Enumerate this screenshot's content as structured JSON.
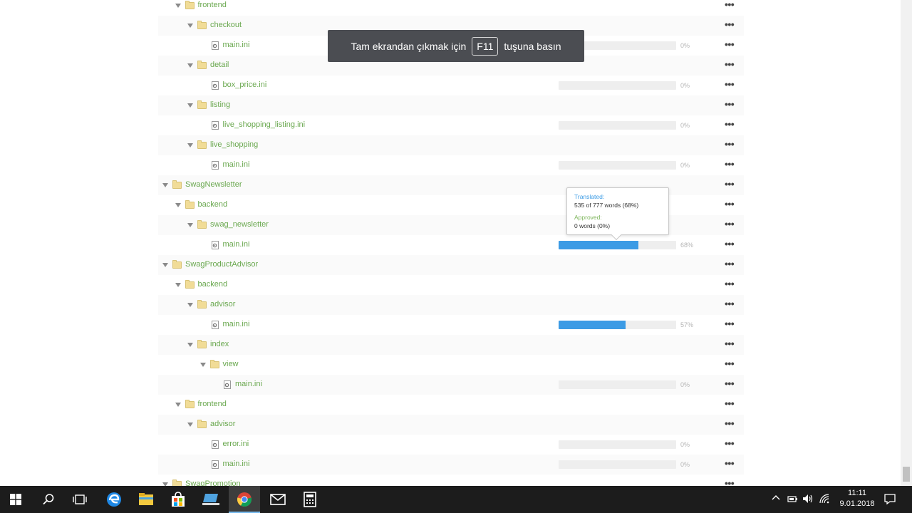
{
  "tree": [
    {
      "depth": 1,
      "kind": "folder",
      "name": "frontend"
    },
    {
      "depth": 2,
      "kind": "folder",
      "name": "checkout"
    },
    {
      "depth": 3,
      "kind": "file",
      "name": "main.ini",
      "progress": 0,
      "percent_label": "0%"
    },
    {
      "depth": 2,
      "kind": "folder",
      "name": "detail"
    },
    {
      "depth": 3,
      "kind": "file",
      "name": "box_price.ini",
      "progress": 0,
      "percent_label": "0%"
    },
    {
      "depth": 2,
      "kind": "folder",
      "name": "listing"
    },
    {
      "depth": 3,
      "kind": "file",
      "name": "live_shopping_listing.ini",
      "progress": 0,
      "percent_label": "0%"
    },
    {
      "depth": 2,
      "kind": "folder",
      "name": "live_shopping"
    },
    {
      "depth": 3,
      "kind": "file",
      "name": "main.ini",
      "progress": 0,
      "percent_label": "0%"
    },
    {
      "depth": 0,
      "kind": "folder",
      "name": "SwagNewsletter"
    },
    {
      "depth": 1,
      "kind": "folder",
      "name": "backend"
    },
    {
      "depth": 2,
      "kind": "folder",
      "name": "swag_newsletter"
    },
    {
      "depth": 3,
      "kind": "file",
      "name": "main.ini",
      "progress": 68,
      "percent_label": "68%"
    },
    {
      "depth": 0,
      "kind": "folder",
      "name": "SwagProductAdvisor"
    },
    {
      "depth": 1,
      "kind": "folder",
      "name": "backend"
    },
    {
      "depth": 2,
      "kind": "folder",
      "name": "advisor"
    },
    {
      "depth": 3,
      "kind": "file",
      "name": "main.ini",
      "progress": 57,
      "percent_label": "57%"
    },
    {
      "depth": 2,
      "kind": "folder",
      "name": "index"
    },
    {
      "depth": 3,
      "kind": "folder",
      "name": "view"
    },
    {
      "depth": 4,
      "kind": "file",
      "name": "main.ini",
      "progress": 0,
      "percent_label": "0%"
    },
    {
      "depth": 1,
      "kind": "folder",
      "name": "frontend"
    },
    {
      "depth": 2,
      "kind": "folder",
      "name": "advisor"
    },
    {
      "depth": 3,
      "kind": "file",
      "name": "error.ini",
      "progress": 0,
      "percent_label": "0%"
    },
    {
      "depth": 3,
      "kind": "file",
      "name": "main.ini",
      "progress": 0,
      "percent_label": "0%"
    },
    {
      "depth": 0,
      "kind": "folder",
      "name": "SwagPromotion"
    }
  ],
  "row_menu_label": "•••",
  "tooltip": {
    "translated_label": "Translated:",
    "translated_value": "535 of 777 words (68%)",
    "approved_label": "Approved:",
    "approved_value": "0 words (0%)"
  },
  "fullscreen_banner": {
    "before": "Tam ekrandan çıkmak için",
    "key": "F11",
    "after": "tuşuna basın"
  },
  "taskbar": {
    "apps": [
      "windows-logo-icon",
      "search-icon",
      "task-view-icon",
      "edge-icon",
      "file-explorer-icon",
      "store-icon",
      "desktop-app-icon",
      "chrome-icon",
      "mail-icon",
      "calculator-icon"
    ],
    "active_app": "chrome-icon",
    "clock_time": "11:11",
    "clock_date": "9.01.2018"
  },
  "colors": {
    "folder_name": "#6aa84f",
    "progress_fill": "#3b9be5",
    "banner_bg": "#4b4d52",
    "taskbar_bg": "#1c1c1c"
  }
}
